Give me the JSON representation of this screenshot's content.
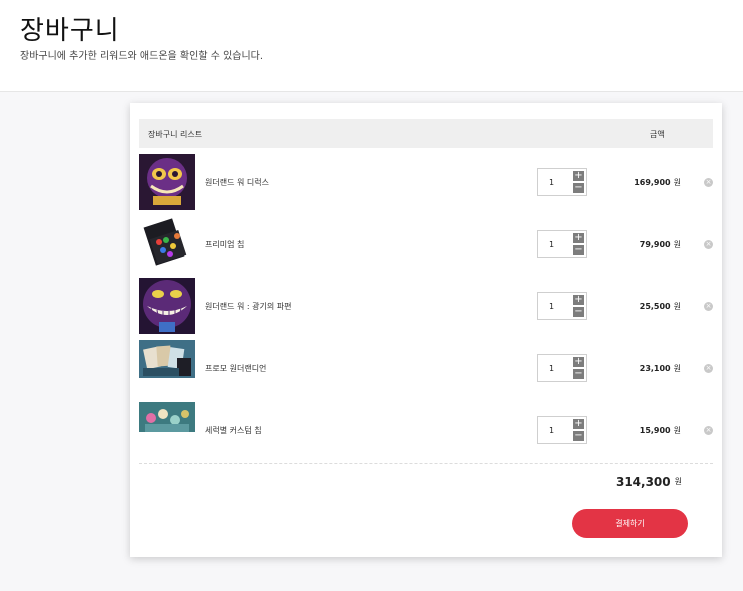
{
  "header": {
    "title": "장바구니",
    "subtitle": "장바구니에 추가한 리워드와 애드온을 확인할 수 있습니다."
  },
  "cart": {
    "list_header": "장바구니 리스트",
    "price_header": "금액",
    "currency_unit": "원",
    "items": [
      {
        "name": "원더랜드 워 디럭스",
        "quantity": "1",
        "price": "169,900",
        "thumb": "wonderland-war-deluxe-box"
      },
      {
        "name": "프리미엄 칩",
        "quantity": "1",
        "price": "79,900",
        "thumb": "premium-chips-tray"
      },
      {
        "name": "원더랜드 워 : 광기의 파편",
        "quantity": "1",
        "price": "25,500",
        "thumb": "cheshire-cat-art"
      },
      {
        "name": "프로모 원더랜디언",
        "quantity": "1",
        "price": "23,100",
        "thumb": "promo-cards"
      },
      {
        "name": "세럭별 커스텀 칩",
        "quantity": "1",
        "price": "15,900",
        "thumb": "custom-chip-figures"
      }
    ],
    "plus_symbol": "+",
    "minus_symbol": "−",
    "remove_symbol": "×",
    "total": "314,300",
    "checkout_label": "결제하기"
  },
  "colors": {
    "accent": "#e33445",
    "header_bg": "#efefef",
    "qty_button": "#7d7d7d"
  }
}
